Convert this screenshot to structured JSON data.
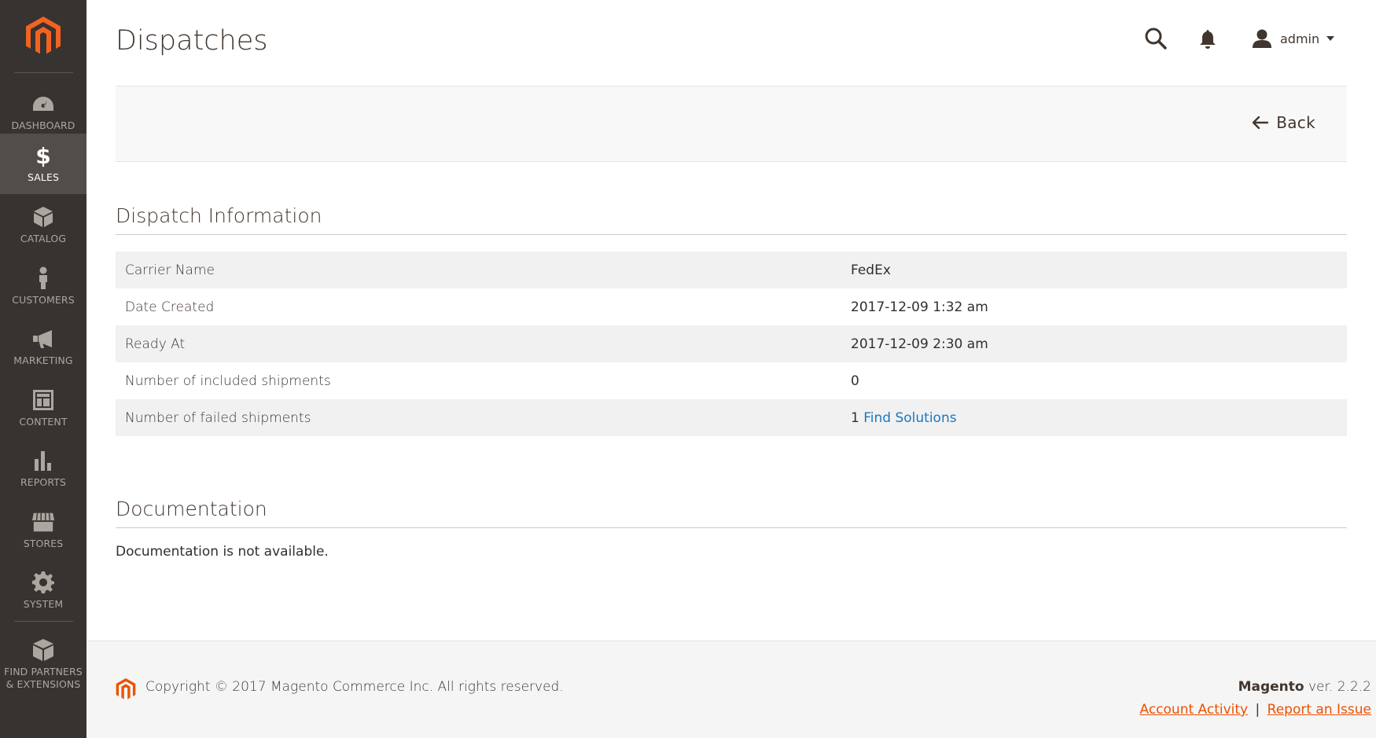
{
  "sidebar": {
    "items": [
      {
        "label": "DASHBOARD",
        "icon": "dashboard-icon"
      },
      {
        "label": "SALES",
        "icon": "dollar-icon",
        "active": true
      },
      {
        "label": "CATALOG",
        "icon": "box-icon"
      },
      {
        "label": "CUSTOMERS",
        "icon": "person-icon"
      },
      {
        "label": "MARKETING",
        "icon": "megaphone-icon"
      },
      {
        "label": "CONTENT",
        "icon": "layout-icon"
      },
      {
        "label": "REPORTS",
        "icon": "bar-chart-icon"
      },
      {
        "label": "STORES",
        "icon": "storefront-icon"
      },
      {
        "label": "SYSTEM",
        "icon": "gear-icon"
      },
      {
        "label": "FIND PARTNERS & EXTENSIONS",
        "label_line1": "FIND PARTNERS",
        "label_line2": "& EXTENSIONS",
        "icon": "cubes-icon"
      }
    ]
  },
  "header": {
    "title": "Dispatches",
    "user": "admin"
  },
  "actions": {
    "back_label": "Back"
  },
  "dispatch_info": {
    "title": "Dispatch Information",
    "rows": [
      {
        "label": "Carrier Name",
        "value": "FedEx"
      },
      {
        "label": "Date Created",
        "value": "2017-12-09 1:32 am"
      },
      {
        "label": "Ready At",
        "value": "2017-12-09 2:30 am"
      },
      {
        "label": "Number of included shipments",
        "value": "0"
      },
      {
        "label": "Number of failed shipments",
        "value": "1",
        "link": "Find Solutions"
      }
    ]
  },
  "documentation": {
    "title": "Documentation",
    "text": "Documentation is not available."
  },
  "footer": {
    "copyright": "Copyright © 2017 Magento Commerce Inc. All rights reserved.",
    "brand": "Magento",
    "version": " ver. 2.2.2",
    "account_activity": "Account Activity",
    "separator": "|",
    "report_issue": "Report an Issue"
  },
  "colors": {
    "sidebar_bg": "#373330",
    "sidebar_active": "#524d49",
    "brand_orange": "#eb5202",
    "link_blue": "#1979c3"
  }
}
